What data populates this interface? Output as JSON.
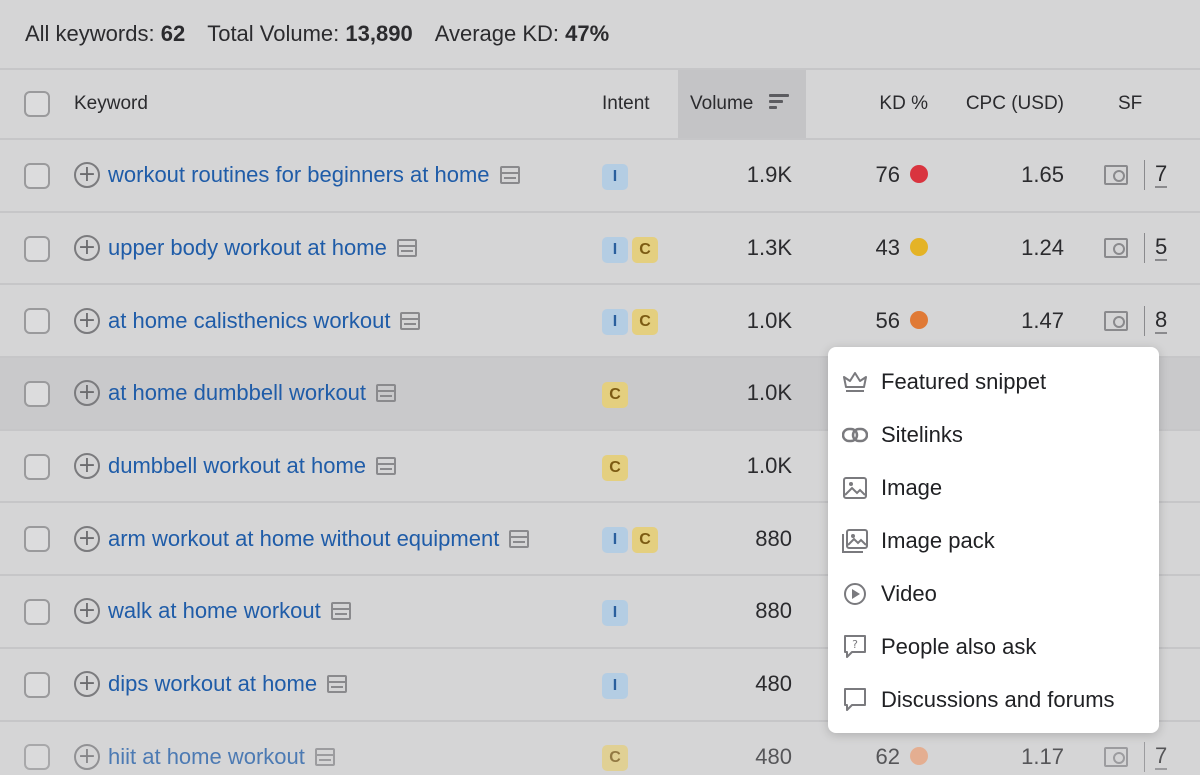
{
  "summary": {
    "all_keywords_label": "All keywords:",
    "all_keywords_value": "62",
    "total_volume_label": "Total Volume:",
    "total_volume_value": "13,890",
    "avg_kd_label": "Average KD:",
    "avg_kd_value": "47%"
  },
  "columns": {
    "keyword": "Keyword",
    "intent": "Intent",
    "volume": "Volume",
    "kd": "KD %",
    "cpc": "CPC (USD)",
    "sf": "SF"
  },
  "rows": [
    {
      "keyword": "workout routines for beginners at home",
      "intents": [
        "I"
      ],
      "volume": "1.9K",
      "kd": "76",
      "kd_color": "#d9343f",
      "cpc": "1.65",
      "sf": "7"
    },
    {
      "keyword": "upper body workout at home",
      "intents": [
        "I",
        "C"
      ],
      "volume": "1.3K",
      "kd": "43",
      "kd_color": "#e4b326",
      "cpc": "1.24",
      "sf": "5"
    },
    {
      "keyword": "at home calisthenics workout",
      "intents": [
        "I",
        "C"
      ],
      "volume": "1.0K",
      "kd": "56",
      "kd_color": "#e07a36",
      "cpc": "1.47",
      "sf": "8"
    },
    {
      "keyword": "at home dumbbell workout",
      "intents": [
        "C"
      ],
      "volume": "1.0K",
      "kd": "",
      "kd_color": "",
      "cpc": "",
      "sf": ""
    },
    {
      "keyword": "dumbbell workout at home",
      "intents": [
        "C"
      ],
      "volume": "1.0K",
      "kd": "",
      "kd_color": "",
      "cpc": "",
      "sf": ""
    },
    {
      "keyword": "arm workout at home without equipment",
      "intents": [
        "I",
        "C"
      ],
      "volume": "880",
      "kd": "",
      "kd_color": "",
      "cpc": "",
      "sf": ""
    },
    {
      "keyword": "walk at home workout",
      "intents": [
        "I"
      ],
      "volume": "880",
      "kd": "",
      "kd_color": "",
      "cpc": "",
      "sf": ""
    },
    {
      "keyword": "dips workout at home",
      "intents": [
        "I"
      ],
      "volume": "480",
      "kd": "",
      "kd_color": "",
      "cpc": "",
      "sf": ""
    },
    {
      "keyword": "hiit at home workout",
      "intents": [
        "C"
      ],
      "volume": "480",
      "kd": "62",
      "kd_color": "#eaa27a",
      "cpc": "1.17",
      "sf": "7"
    }
  ],
  "serp_features_menu": [
    {
      "label": "Featured snippet",
      "icon": "crown-icon"
    },
    {
      "label": "Sitelinks",
      "icon": "link-icon"
    },
    {
      "label": "Image",
      "icon": "image-icon"
    },
    {
      "label": "Image pack",
      "icon": "image-pack-icon"
    },
    {
      "label": "Video",
      "icon": "play-icon"
    },
    {
      "label": "People also ask",
      "icon": "question-bubble-icon"
    },
    {
      "label": "Discussions and forums",
      "icon": "chat-bubble-icon"
    }
  ]
}
